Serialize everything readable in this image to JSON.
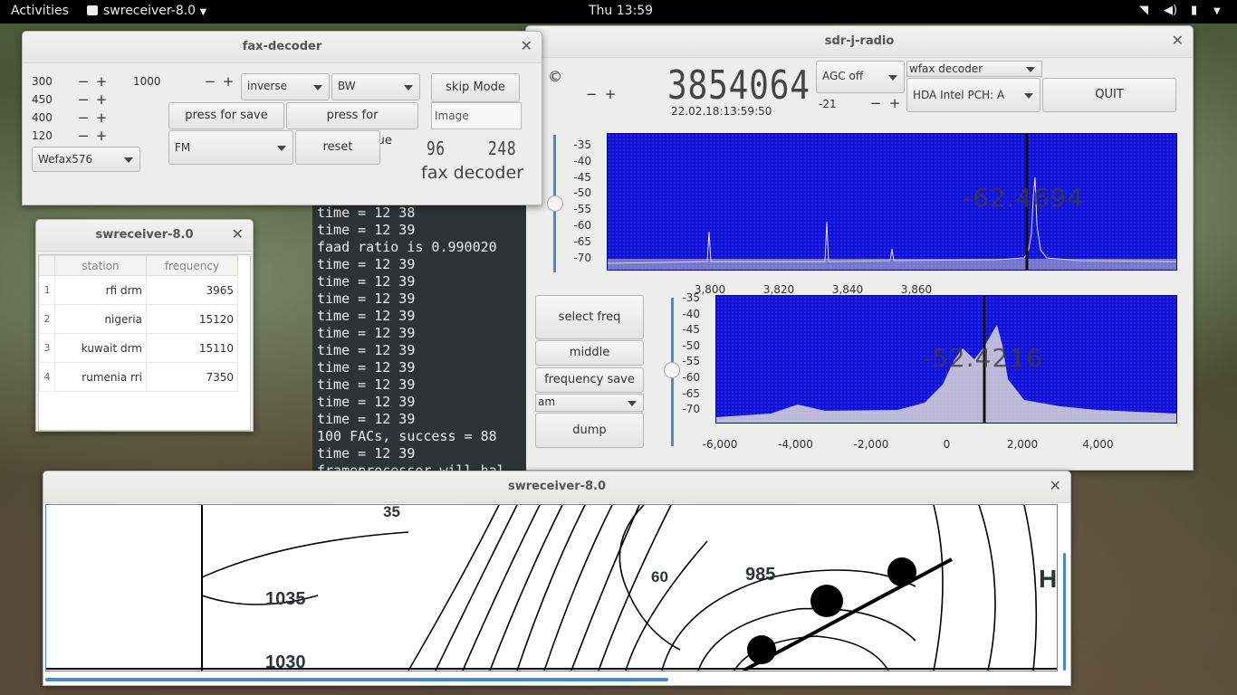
{
  "topbar": {
    "activities": "Activities",
    "app_menu": "swreceiver-8.0",
    "clock": "Thu 13:59"
  },
  "fax_window": {
    "title": "fax-decoder",
    "spin_values": [
      "300",
      "450",
      "400",
      "120"
    ],
    "freq_value": "1000",
    "phase_combo": "inverse",
    "color_combo": "BW",
    "skip_button": "skip Mode",
    "save_button": "press for save",
    "autocontinue_button": "press for autoContinue",
    "image_field": "Image",
    "mode_combo": "Wefax576",
    "modulation_combo": "FM",
    "reset_button": "reset",
    "counter_left": "96",
    "counter_right": "248",
    "label": "fax decoder"
  },
  "station_window": {
    "title": "swreceiver-8.0",
    "headers": [
      "station",
      "frequency"
    ],
    "rows": [
      {
        "n": "1",
        "station": "rfi drm",
        "frequency": "3965"
      },
      {
        "n": "2",
        "station": "nigeria",
        "frequency": "15120"
      },
      {
        "n": "3",
        "station": "kuwait drm",
        "frequency": "15110"
      },
      {
        "n": "4",
        "station": "rumenia rri",
        "frequency": "7350"
      }
    ]
  },
  "terminal": {
    "lines": [
      "time = 12 38",
      "time = 12 39",
      "faad ratio is 0.990020",
      "time = 12 39",
      "time = 12 39",
      "time = 12 39",
      "time = 12 39",
      "time = 12 39",
      "time = 12 39",
      "time = 12 39",
      "time = 12 39",
      "time = 12 39",
      "time = 12 39",
      "100 FACs, success = 88",
      "time = 12 39",
      "frameprocessor will hal"
    ]
  },
  "sdr_window": {
    "title": "sdr-j-radio",
    "copyright": "©",
    "lcd_freq": "3854064",
    "datetime": "22.02.18:13:59:50",
    "agc_combo": "AGC off",
    "decoder_combo": "wfax decoder",
    "gain_value": "-21",
    "device_combo": "HDA Intel PCH: A",
    "quit_button": "QUIT",
    "select_freq_button": "select freq",
    "middle_button": "middle",
    "freq_save_button": "frequency save",
    "am_combo": "am",
    "dump_button": "dump",
    "spectrum": {
      "level_readout": "-62.4694",
      "yticks": [
        "-35",
        "-40",
        "-45",
        "-50",
        "-55",
        "-60",
        "-65",
        "-70"
      ],
      "xticks": [
        "3,800",
        "3,820",
        "3,840",
        "3,860"
      ]
    },
    "lowpass": {
      "level_readout": "-52.4216",
      "yticks": [
        "-35",
        "-40",
        "-45",
        "-50",
        "-55",
        "-60",
        "-65",
        "-70"
      ],
      "xticks": [
        "-6,000",
        "-4,000",
        "-2,000",
        "0",
        "2,000",
        "4,000"
      ]
    }
  },
  "image_window": {
    "title": "swreceiver-8.0",
    "map_labels": [
      "1035",
      "1030",
      "985",
      "60",
      "35",
      "H"
    ]
  }
}
